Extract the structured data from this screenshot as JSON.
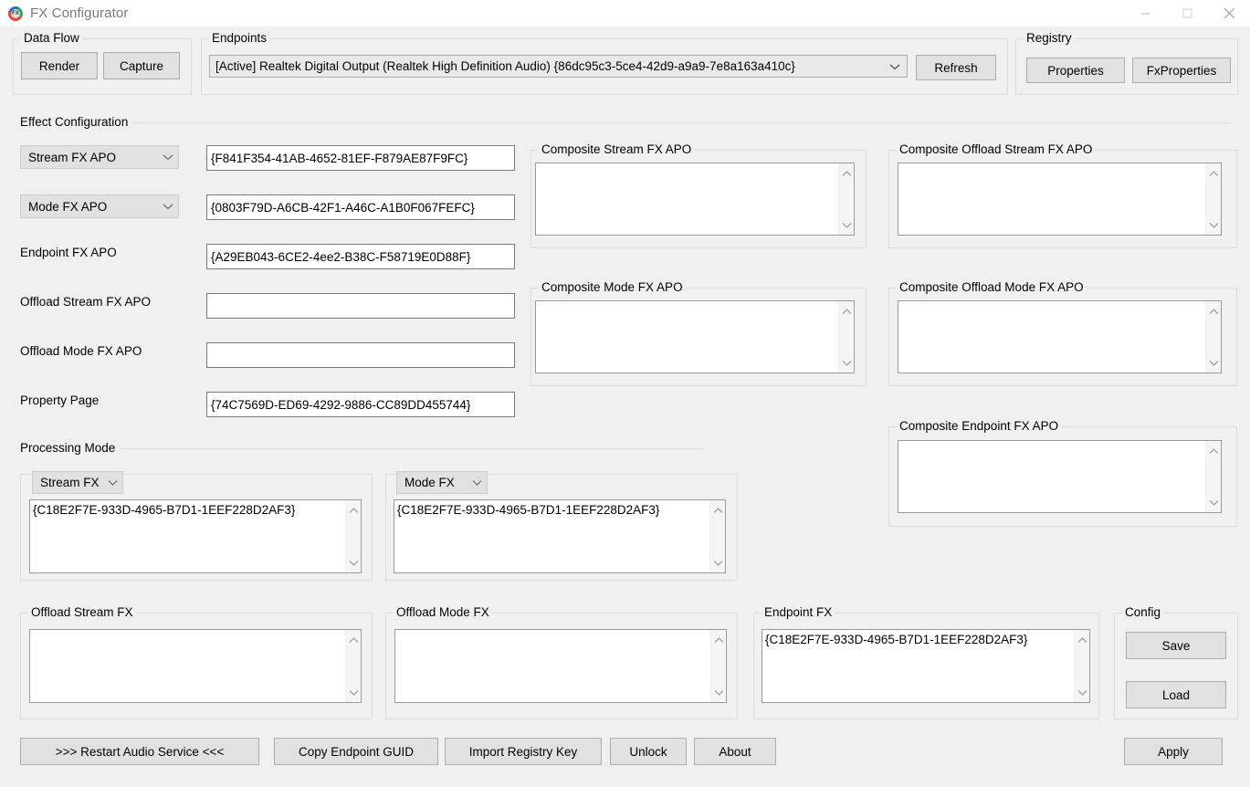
{
  "window": {
    "title": "FX Configurator",
    "icon": "fx-app-icon",
    "controls": {
      "minimize": "minimize-icon",
      "maximize": "maximize-icon",
      "close": "close-icon"
    }
  },
  "data_flow": {
    "group_title": "Data Flow",
    "render_label": "Render",
    "capture_label": "Capture"
  },
  "endpoints": {
    "group_title": "Endpoints",
    "selected": "[Active] Realtek Digital Output (Realtek High Definition Audio) {86dc95c3-5ce4-42d9-a9a9-7e8a163a410c}",
    "refresh_label": "Refresh"
  },
  "registry": {
    "group_title": "Registry",
    "properties_label": "Properties",
    "fxproperties_label": "FxProperties"
  },
  "effect_configuration": {
    "section_title": "Effect Configuration",
    "rows": [
      {
        "type": "combo",
        "label": "Stream FX APO",
        "value": "{F841F354-41AB-4652-81EF-F879AE87F9FC}"
      },
      {
        "type": "combo",
        "label": "Mode FX APO",
        "value": "{0803F79D-A6CB-42F1-A46C-A1B0F067FEFC}"
      },
      {
        "type": "label",
        "label": "Endpoint FX APO",
        "value": "{A29EB043-6CE2-4ee2-B38C-F58719E0D88F}"
      },
      {
        "type": "label",
        "label": "Offload Stream FX APO",
        "value": ""
      },
      {
        "type": "label",
        "label": "Offload Mode FX APO",
        "value": ""
      },
      {
        "type": "label",
        "label": "Property Page",
        "value": "{74C7569D-ED69-4292-9886-CC89DD455744}"
      }
    ]
  },
  "composite": {
    "stream": {
      "title": "Composite Stream FX APO",
      "value": ""
    },
    "mode": {
      "title": "Composite Mode FX APO",
      "value": ""
    },
    "offload_stream": {
      "title": "Composite Offload Stream FX APO",
      "value": ""
    },
    "offload_mode": {
      "title": "Composite Offload Mode FX APO",
      "value": ""
    },
    "endpoint": {
      "title": "Composite Endpoint FX APO",
      "value": ""
    }
  },
  "processing_mode": {
    "section_title": "Processing Mode",
    "stream_fx": {
      "combo_label": "Stream FX",
      "value": "{C18E2F7E-933D-4965-B7D1-1EEF228D2AF3}"
    },
    "mode_fx": {
      "combo_label": "Mode FX",
      "value": "{C18E2F7E-933D-4965-B7D1-1EEF228D2AF3}"
    },
    "offload_stream_fx": {
      "title": "Offload Stream FX",
      "value": ""
    },
    "offload_mode_fx": {
      "title": "Offload Mode FX",
      "value": ""
    },
    "endpoint_fx": {
      "title": "Endpoint FX",
      "value": "{C18E2F7E-933D-4965-B7D1-1EEF228D2AF3}"
    }
  },
  "config": {
    "group_title": "Config",
    "save_label": "Save",
    "load_label": "Load"
  },
  "actions": {
    "restart_label": ">>> Restart Audio Service <<<",
    "copy_guid_label": "Copy Endpoint GUID",
    "import_key_label": "Import Registry Key",
    "unlock_label": "Unlock",
    "about_label": "About",
    "apply_label": "Apply"
  },
  "colors": {
    "window_bg": "#f0f0f0",
    "button_face": "#e1e1e1",
    "button_border": "#adadad",
    "field_bg": "#ffffff",
    "field_border": "#7a7a7a",
    "group_border": "#dcdcdc",
    "title_text": "#7a7a7a"
  }
}
